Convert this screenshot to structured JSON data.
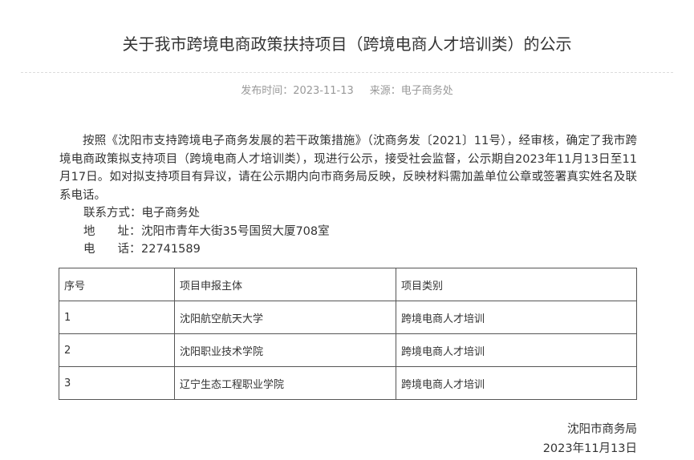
{
  "title": "关于我市跨境电商政策扶持项目（跨境电商人才培训类）的公示",
  "meta": {
    "date_label": "发布时间：",
    "date": "2023-11-13",
    "source_label": "来源：",
    "source": "电子商务处"
  },
  "body": {
    "paragraph": "按照《沈阳市支持跨境电子商务发展的若干政策措施》（沈商务发〔2021〕11号），经审核，确定了我市跨境电商政策拟支持项目（跨境电商人才培训类），现进行公示，接受社会监督，公示期自2023年11月13日至11月17日。如对拟支持项目有异议，请在公示期内向市商务局反映，反映材料需加盖单位公章或签署真实姓名及联系电话。",
    "contact_label": "联系方式：",
    "contact_value": "电子商务处",
    "address_label_1": "地",
    "address_label_2": "址：",
    "address_value": "沈阳市青年大街35号国贸大厦708室",
    "phone_label_1": "电",
    "phone_label_2": "话：",
    "phone_value": "22741589"
  },
  "table": {
    "headers": [
      "序号",
      "项目申报主体",
      "项目类别"
    ],
    "rows": [
      [
        "1",
        "沈阳航空航天大学",
        "跨境电商人才培训"
      ],
      [
        "2",
        "沈阳职业技术学院",
        "跨境电商人才培训"
      ],
      [
        "3",
        "辽宁生态工程职业学院",
        "跨境电商人才培训"
      ]
    ]
  },
  "signature": {
    "org": "沈阳市商务局",
    "date": "2023年11月13日"
  }
}
